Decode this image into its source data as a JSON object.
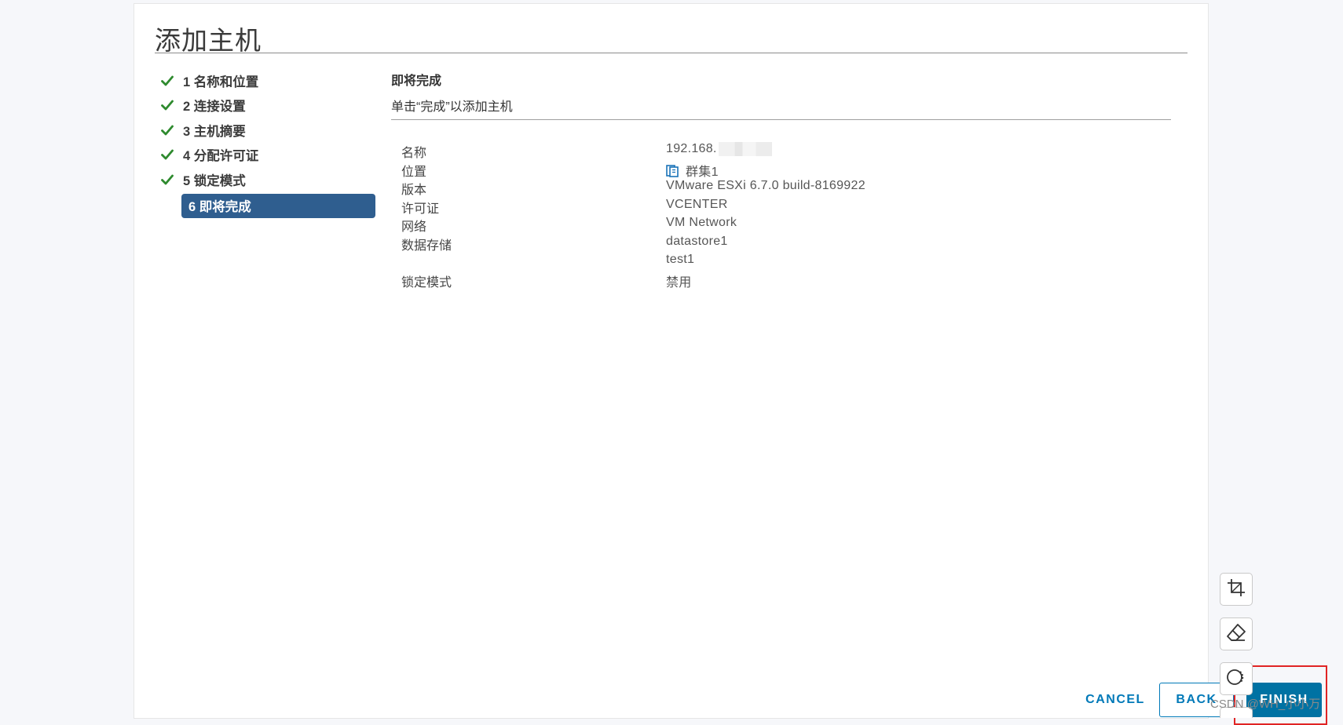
{
  "dialog": {
    "title": "添加主机"
  },
  "steps": [
    {
      "label": "1 名称和位置",
      "done": true
    },
    {
      "label": "2 连接设置",
      "done": true
    },
    {
      "label": "3 主机摘要",
      "done": true
    },
    {
      "label": "4 分配许可证",
      "done": true
    },
    {
      "label": "5 锁定模式",
      "done": true
    },
    {
      "label": "6 即将完成",
      "active": true
    }
  ],
  "content": {
    "heading": "即将完成",
    "subtitle": "单击“完成”以添加主机"
  },
  "details": {
    "name_label": "名称",
    "name_value": "192.168.",
    "location_label": "位置",
    "location_value": "群集1",
    "version_label": "版本",
    "version_value": "VMware ESXi 6.7.0 build-8169922",
    "license_label": "许可证",
    "license_value": "VCENTER",
    "network_label": "网络",
    "network_value": "VM Network",
    "datastore_label": "数据存储",
    "datastore_value_1": "datastore1",
    "datastore_value_2": "test1",
    "lockdown_label": "锁定模式",
    "lockdown_value": "禁用"
  },
  "footer": {
    "cancel_label": "CANCEL",
    "back_label": "BACK",
    "finish_label": "FINISH"
  },
  "tools": [
    "crop-icon",
    "eraser-icon",
    "circle-icon"
  ],
  "watermark": "CSDN @WH_小小万",
  "colors": {
    "accent": "#0079b8",
    "primary_button": "#0072a3",
    "active_step": "#2f5e8f",
    "check": "#2e8a2e",
    "highlight_box": "#e02424"
  }
}
